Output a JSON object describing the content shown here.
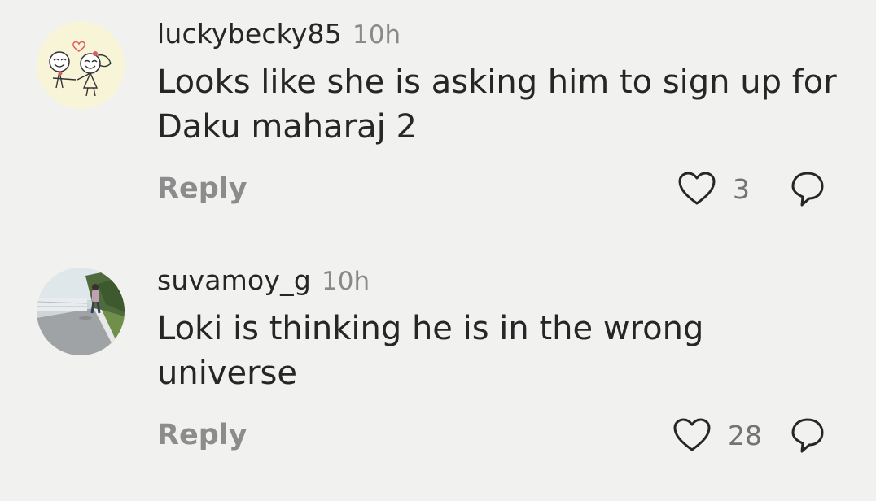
{
  "comments": [
    {
      "username": "luckybecky85",
      "time": "10h",
      "text": "Looks like she is asking him to sign up for Daku maharaj 2",
      "reply_label": "Reply",
      "likes": "3",
      "avatar": "cartoon-couple-avatar"
    },
    {
      "username": "suvamoy_g",
      "time": "10h",
      "text": "Loki is thinking he is in the wrong universe",
      "reply_label": "Reply",
      "likes": "28",
      "avatar": "road-photo-avatar"
    }
  ],
  "colors": {
    "background": "#f1f1f0",
    "text": "#262626",
    "secondary": "#8a8a8a"
  }
}
